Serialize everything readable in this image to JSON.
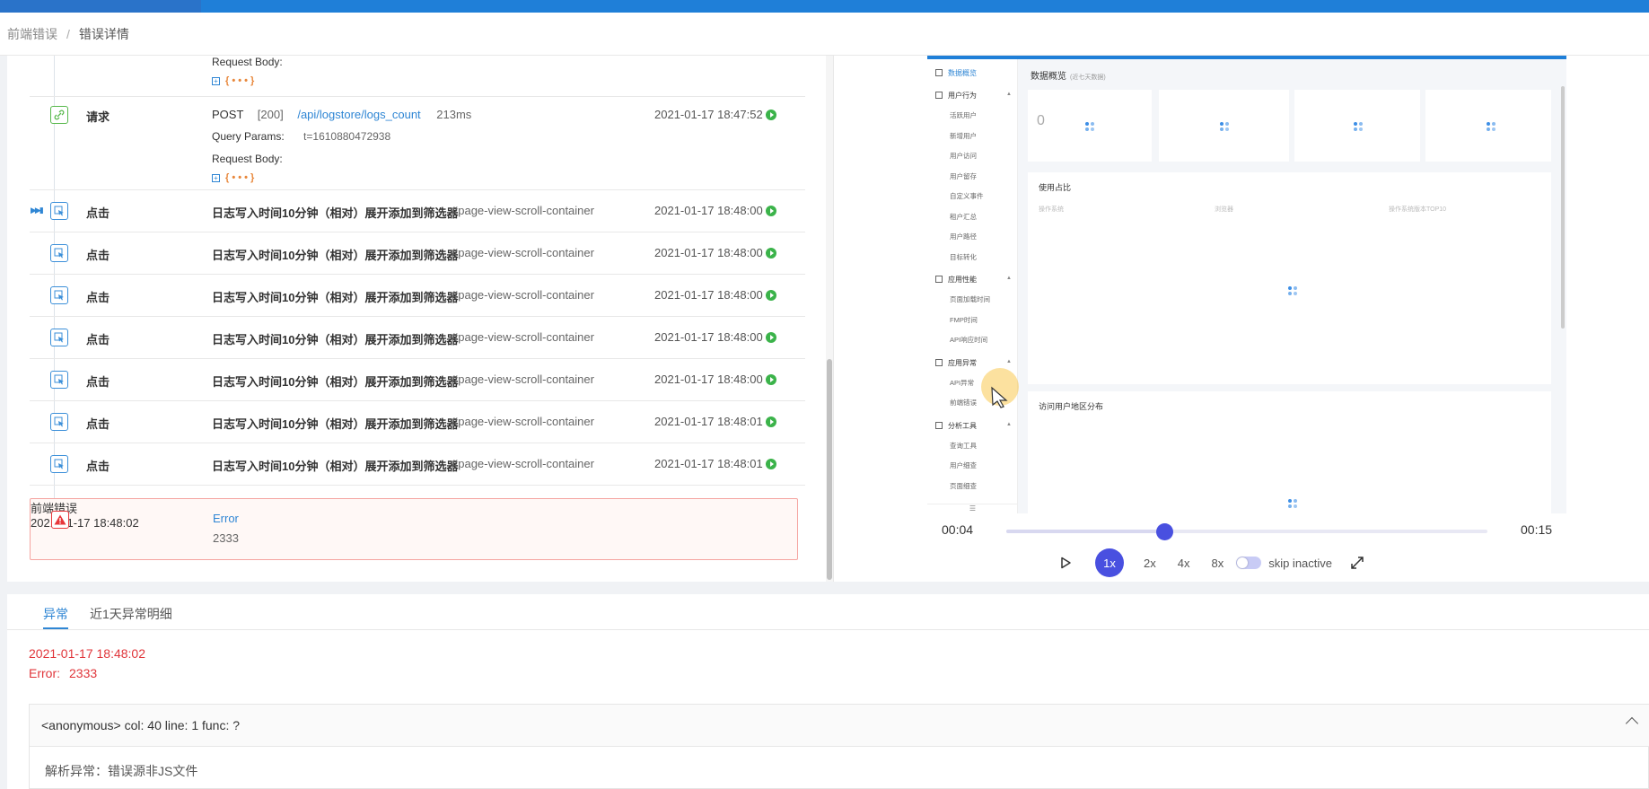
{
  "breadcrumb": {
    "parent": "前端错误",
    "current": "错误详情"
  },
  "timeline": {
    "partial_top": {
      "label": "Request Body:",
      "body": "{ • • • }"
    },
    "request_row": {
      "type": "请求",
      "method": "POST",
      "status": "[200]",
      "url": "/api/logstore/logs_count",
      "duration": "213ms",
      "time": "2021-01-17 18:47:52",
      "query_label": "Query Params:",
      "query_value": "t=1610880472938",
      "body_label": "Request Body:",
      "body_value": "{ • • • }"
    },
    "click_rows": [
      {
        "type": "点击",
        "desc": "日志写入时间10分钟（相对）展开添加到筛选器",
        "selector": "#page-view-scroll-container",
        "time": "2021-01-17 18:48:00"
      },
      {
        "type": "点击",
        "desc": "日志写入时间10分钟（相对）展开添加到筛选器",
        "selector": "#page-view-scroll-container",
        "time": "2021-01-17 18:48:00"
      },
      {
        "type": "点击",
        "desc": "日志写入时间10分钟（相对）展开添加到筛选器",
        "selector": "#page-view-scroll-container",
        "time": "2021-01-17 18:48:00"
      },
      {
        "type": "点击",
        "desc": "日志写入时间10分钟（相对）展开添加到筛选器",
        "selector": "#page-view-scroll-container",
        "time": "2021-01-17 18:48:00"
      },
      {
        "type": "点击",
        "desc": "日志写入时间10分钟（相对）展开添加到筛选器",
        "selector": "#page-view-scroll-container",
        "time": "2021-01-17 18:48:00"
      },
      {
        "type": "点击",
        "desc": "日志写入时间10分钟（相对）展开添加到筛选器",
        "selector": "#page-view-scroll-container",
        "time": "2021-01-17 18:48:01"
      },
      {
        "type": "点击",
        "desc": "日志写入时间10分钟（相对）展开添加到筛选器",
        "selector": "#page-view-scroll-container",
        "time": "2021-01-17 18:48:01"
      }
    ],
    "error_row": {
      "type": "前端错误",
      "name": "Error",
      "message": "2333",
      "time": "2021-01-17 18:48:02"
    }
  },
  "player": {
    "mini_app": {
      "title": "数据概览",
      "title_note": "(近七天数据)",
      "first_card_value": "0",
      "section_usage": "使用占比",
      "usage_cols": [
        "操作系统",
        "浏览器",
        "操作系统版本TOP10"
      ],
      "section_region": "访问用户地区分布",
      "menu": [
        {
          "group": "数据概览"
        },
        {
          "group": "用户行为",
          "items": [
            "活跃用户",
            "新增用户",
            "用户访问",
            "用户留存",
            "自定义事件",
            "租户汇总",
            "用户路径",
            "目标转化"
          ]
        },
        {
          "group": "应用性能",
          "items": [
            "页面加载时间",
            "FMP时间",
            "API响应时间"
          ]
        },
        {
          "group": "应用异常",
          "items": [
            "API异常",
            "前端错误"
          ]
        },
        {
          "group": "分析工具",
          "items": [
            "查询工具",
            "用户细查",
            "页面细查"
          ]
        }
      ]
    },
    "current_time": "00:04",
    "total_time": "00:15",
    "progress_fraction": 0.27,
    "speeds": [
      "1x",
      "2x",
      "4x",
      "8x"
    ],
    "active_speed": "1x",
    "skip_inactive_label": "skip inactive"
  },
  "detail": {
    "tabs": [
      "异常",
      "近1天异常明细"
    ],
    "active_tab": "异常",
    "error_time": "2021-01-17 18:48:02",
    "error_label": "Error:",
    "error_value": "2333",
    "stack_frame": "<anonymous> col: 40 line: 1 func: ?",
    "parse_result": "解析异常：错误源非JS文件"
  },
  "colors": {
    "accent": "#2f86d4",
    "player": "#4950e0",
    "error": "#e0353a",
    "success": "#3bb34a"
  }
}
